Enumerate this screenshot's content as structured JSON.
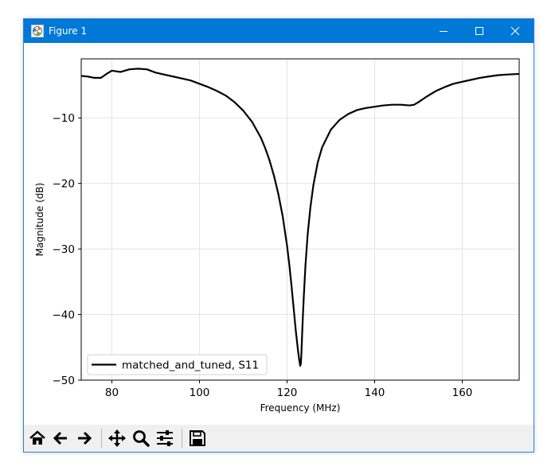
{
  "window": {
    "title": "Figure 1"
  },
  "toolbar": {
    "icons": [
      "home-icon",
      "back-arrow-icon",
      "forward-arrow-icon",
      "pan-icon",
      "zoom-icon",
      "configure-subplots-icon",
      "save-icon"
    ]
  },
  "chart_data": {
    "type": "line",
    "title": "",
    "xlabel": "Frequency (MHz)",
    "ylabel": "Magnitude (dB)",
    "xlim": [
      73,
      173
    ],
    "ylim": [
      -50,
      -1
    ],
    "xticks": [
      80,
      100,
      120,
      140,
      160
    ],
    "yticks": [
      -10,
      -20,
      -30,
      -40,
      -50
    ],
    "xtick_labels": [
      "80",
      "100",
      "120",
      "140",
      "160"
    ],
    "ytick_labels": [
      "−10",
      "−20",
      "−30",
      "−40",
      "−50"
    ],
    "grid": true,
    "legend": {
      "position": "lower-left",
      "entries": [
        "matched_and_tuned, S11"
      ]
    },
    "line_color": "#000000",
    "series": [
      {
        "name": "matched_and_tuned, S11",
        "x": [
          73,
          74.5,
          76,
          77.5,
          79,
          80,
          81,
          82,
          84,
          86,
          88,
          90,
          92,
          94,
          96,
          98,
          100,
          102,
          104,
          106,
          108,
          110,
          112,
          114,
          115,
          116,
          117,
          118,
          119,
          120,
          120.5,
          121,
          121.5,
          122,
          122.5,
          122.8,
          123,
          123.15,
          123.3,
          123.5,
          123.8,
          124.2,
          124.7,
          125.3,
          126,
          127,
          128,
          130,
          132,
          134,
          136,
          138,
          140,
          142,
          144,
          146,
          148,
          149,
          150,
          152,
          154,
          156,
          158,
          160,
          162,
          164,
          166,
          168,
          170,
          173
        ],
        "y": [
          -3.6,
          -3.7,
          -3.9,
          -3.9,
          -3.2,
          -2.8,
          -2.9,
          -3.0,
          -2.6,
          -2.5,
          -2.6,
          -3.1,
          -3.4,
          -3.7,
          -4.0,
          -4.3,
          -4.8,
          -5.3,
          -5.9,
          -6.6,
          -7.6,
          -8.9,
          -10.6,
          -13.0,
          -14.6,
          -16.5,
          -18.8,
          -21.6,
          -25.0,
          -29.5,
          -32.3,
          -35.5,
          -39.0,
          -42.5,
          -45.5,
          -47.0,
          -47.8,
          -47.5,
          -45.5,
          -42.0,
          -37.5,
          -32.5,
          -27.8,
          -23.8,
          -20.3,
          -16.8,
          -14.5,
          -11.8,
          -10.3,
          -9.4,
          -8.8,
          -8.5,
          -8.3,
          -8.1,
          -8.0,
          -8.0,
          -8.1,
          -8.0,
          -7.6,
          -6.7,
          -5.9,
          -5.3,
          -4.8,
          -4.5,
          -4.2,
          -3.9,
          -3.7,
          -3.5,
          -3.4,
          -3.3
        ]
      }
    ]
  }
}
